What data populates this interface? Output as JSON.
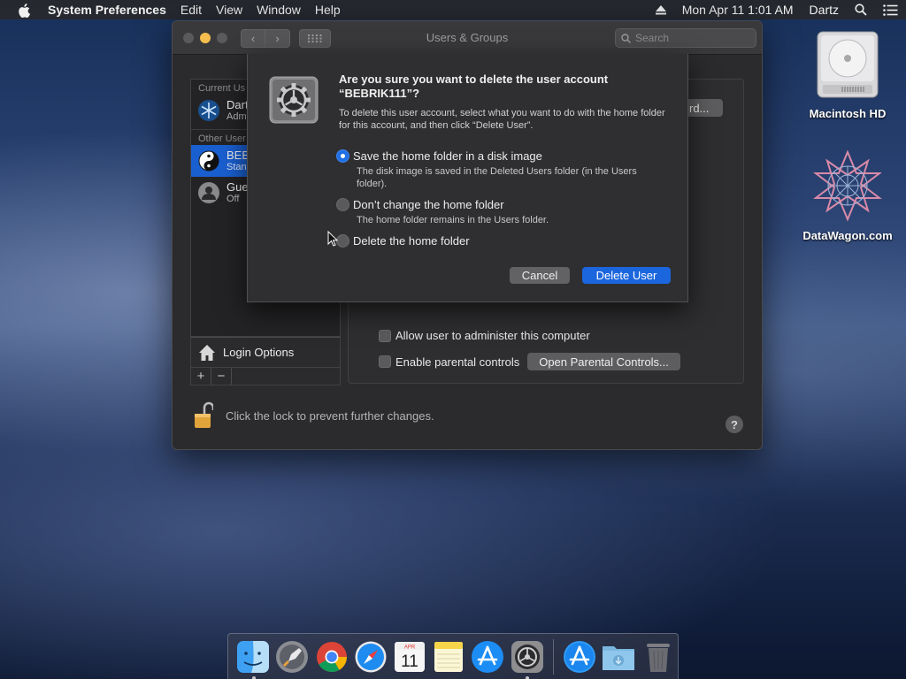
{
  "menubar": {
    "app_name": "System Preferences",
    "menus": [
      "Edit",
      "View",
      "Window",
      "Help"
    ],
    "datetime": "Mon Apr 11  1:01 AM",
    "user": "Dartz"
  },
  "window": {
    "title": "Users & Groups",
    "search_placeholder": "Search",
    "userlist": {
      "current_header": "Current Us",
      "current_user": {
        "name": "Dart",
        "role": "Admi"
      },
      "other_header": "Other User",
      "selected_user": {
        "name": "BEB",
        "role": "Stan"
      },
      "guest_user": {
        "name": "Gue",
        "role": "Off"
      }
    },
    "login_options": "Login Options",
    "add_button": "+",
    "remove_button": "−",
    "password_button": "rd...",
    "allow_admin": "Allow user to administer this computer",
    "parental_controls": "Enable parental controls",
    "open_parental_button": "Open Parental Controls...",
    "lock_text": "Click the lock to prevent further changes.",
    "help_button": "?"
  },
  "dialog": {
    "title_line1": "Are you sure you want to delete the user account",
    "title_line2": "“BEBRIK111”?",
    "description": "To delete this user account, select what you want to do with the home folder for this account, and then click “Delete User”.",
    "options": [
      {
        "label": "Save the home folder in a disk image",
        "sub": "The disk image is saved in the Deleted Users folder (in the Users folder).",
        "selected": true
      },
      {
        "label": "Don’t change the home folder",
        "sub": "The home folder remains in the Users folder.",
        "selected": false
      },
      {
        "label": "Delete the home folder",
        "sub": "",
        "selected": false
      }
    ],
    "cancel": "Cancel",
    "delete": "Delete User"
  },
  "desktop": {
    "icons": [
      {
        "label": "Macintosh HD",
        "icon": "hard-drive-icon"
      },
      {
        "label": "DataWagon.com",
        "icon": "datawagon-logo-icon"
      }
    ]
  },
  "dock": {
    "apps": [
      "finder-icon",
      "launchpad-icon",
      "chrome-icon",
      "safari-icon",
      "calendar-icon",
      "notes-icon",
      "app-store-icon",
      "system-preferences-icon",
      "app-store-icon",
      "downloads-folder-icon",
      "trash-icon"
    ],
    "calendar_month": "APR",
    "calendar_day": "11"
  },
  "colors": {
    "accent": "#1b66dd",
    "selection": "#1a5fd0"
  }
}
